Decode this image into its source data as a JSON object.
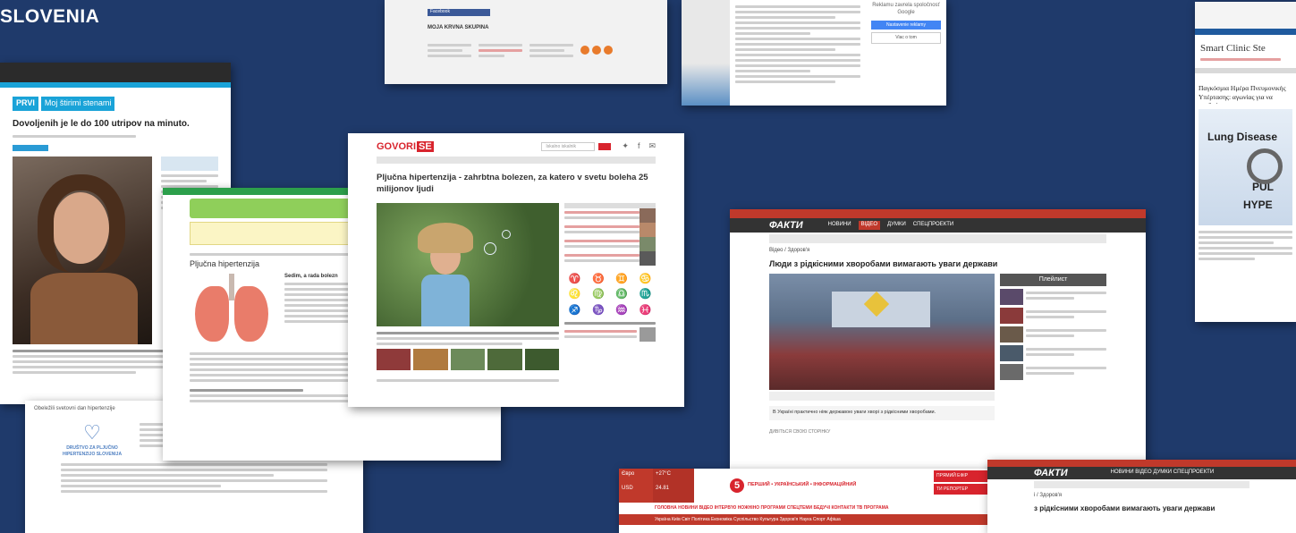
{
  "heading": "SLOVENIA",
  "c1": {
    "badge": "PRVI",
    "section": "Moj štirimi stenami",
    "headline": "Dovoljenih je le do 100 utripov na minuto."
  },
  "c2": {
    "subtitle": "Pljučna hipertenzija",
    "side_title": "Sedim, a rada bolezn"
  },
  "c3": {
    "logo": "GOVORI",
    "logo_suffix": "SE",
    "search_placeholder": "Iskalno iskalnik",
    "headline": "Pljučna hipertenzija - zahrbtna bolezen, za katero v svetu boleha 25 milijonov ljudi"
  },
  "c4": {
    "ad_title": "Reklamu zavrela spoločnosť Google",
    "ad_button": "Nastavenie reklamy",
    "ad_link": "Viac o tom"
  },
  "c5": {
    "top": "Facebook",
    "label": "MOJA KRVNA SKUPINA"
  },
  "c6": {
    "logo": "ФАКТИ",
    "nav": [
      "НОВИНИ",
      "ВІДЕО",
      "ДУМКИ",
      "СПЕЦПРОЕКТИ"
    ],
    "breadcrumb": "Відео / Здоров'я",
    "headline": "Люди з рідкісними хворобами вимагають уваги держави",
    "side_header": "Плейлист",
    "caption": "В Україні практично ніяк державою уваги хворі з рідкісними хворобами.",
    "footer_link": "ДИВІТЬСЯ СВОЮ СТОРІНКУ"
  },
  "c7": {
    "title": "Smart Clinic Ste",
    "headline": "Παγκόσμια Ημέρα Πνευμονικής Υπέρτασης: αγωνίας για να σταθούμε",
    "image_text1": "Lung Disease",
    "image_text2": "PUL",
    "image_text3": "HYPE"
  },
  "c8": {
    "channel_number": "5",
    "channel_name": "ПЕРШИЙ • УКРАЇНСЬКИЙ • ІНФОРМАЦІЙНИЙ",
    "temp": "+27°C",
    "eur_label": "Євро",
    "usd_label": "USD",
    "usd_value": "24.81",
    "live_button": "ПРЯМИЙ ЕФІР",
    "reporter_button": "ТИ РЕПОРТЕР",
    "nav": "ГОЛОВНА  НОВИНИ  ВІДЕО  ІНТЕРВ'Ю  НОЖНІНО  ПРОГРАМИ  СПЕЦТЕМИ  БЕДУЧІ  КОНТАКТИ  ТВ ПРОГРАМА",
    "subnav": "Україна  Київ  Світ  Політика  Економіка  Суспільство  Культура  Здоров'я  Наука  Спорт  Афіша"
  },
  "c9": {
    "logo": "ФАКТИ",
    "nav": "НОВИНИ  ВІДЕО  ДУМКИ  СПЕЦПРОЕКТИ",
    "breadcrumb": "і / Здоров'я",
    "headline": "з рідкісними хворобами вимагають уваги держави"
  },
  "c10": {
    "logo_text": "DRUŠTVO ZA PLJUČNO HIPERTENZIJO SLOVENIJA",
    "header": "Obeležili svetovni dan hipertenzije"
  },
  "colors": {
    "background": "#1f3a6b",
    "accent_red": "#d8242d",
    "fakty_red": "#c0392b"
  }
}
